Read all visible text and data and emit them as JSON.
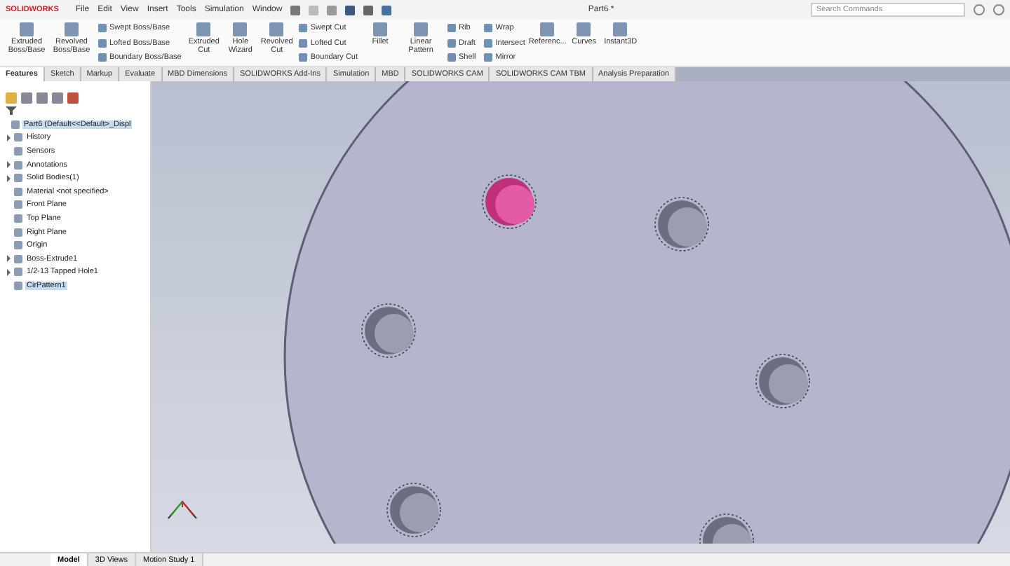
{
  "app": {
    "logo": "SOLIDWORKS",
    "menu": [
      "File",
      "Edit",
      "View",
      "Insert",
      "Tools",
      "Simulation",
      "Window"
    ],
    "title": "Part6 *",
    "search": {
      "placeholder": "Search Commands"
    }
  },
  "ribbon": [
    {
      "kind": "large",
      "label": "Extruded Boss/Base"
    },
    {
      "kind": "large",
      "label": "Revolved Boss/Base"
    },
    {
      "kind": "stack",
      "items": [
        "Swept Boss/Base",
        "Lofted Boss/Base",
        "Boundary Boss/Base"
      ]
    },
    {
      "kind": "large",
      "label": "Extruded Cut"
    },
    {
      "kind": "large",
      "label": "Hole Wizard"
    },
    {
      "kind": "large",
      "label": "Revolved Cut"
    },
    {
      "kind": "stack",
      "items": [
        "Swept Cut",
        "Lofted Cut",
        "Boundary Cut"
      ]
    },
    {
      "kind": "large",
      "label": "Fillet"
    },
    {
      "kind": "large",
      "label": "Linear Pattern"
    },
    {
      "kind": "stack",
      "items": [
        "Rib",
        "Draft",
        "Shell"
      ]
    },
    {
      "kind": "stack",
      "items": [
        "Wrap",
        "Intersect",
        "Mirror"
      ]
    },
    {
      "kind": "large",
      "label": "Referenc..."
    },
    {
      "kind": "large",
      "label": "Curves"
    },
    {
      "kind": "large",
      "label": "Instant3D"
    }
  ],
  "tabs": [
    {
      "label": "Features",
      "selected": true
    },
    {
      "label": "Sketch",
      "selected": false
    },
    {
      "label": "Markup",
      "selected": false
    },
    {
      "label": "Evaluate",
      "selected": false
    },
    {
      "label": "MBD Dimensions",
      "selected": false
    },
    {
      "label": "SOLIDWORKS Add-Ins",
      "selected": false
    },
    {
      "label": "Simulation",
      "selected": false
    },
    {
      "label": "MBD",
      "selected": false
    },
    {
      "label": "SOLIDWORKS CAM",
      "selected": false
    },
    {
      "label": "SOLIDWORKS CAM TBM",
      "selected": false
    },
    {
      "label": "Analysis Preparation",
      "selected": false
    }
  ],
  "tree": {
    "label": "Part6  (Default<<Default>_Displ",
    "selected": true,
    "children": [
      {
        "label": "History",
        "expanded": false,
        "selected": false
      },
      {
        "label": "Sensors",
        "selected": false
      },
      {
        "label": "Annotations",
        "expanded": false,
        "selected": false
      },
      {
        "label": "Solid Bodies(1)",
        "expanded": false,
        "selected": false
      },
      {
        "label": "Material <not specified>",
        "selected": false
      },
      {
        "label": "Front Plane",
        "selected": false
      },
      {
        "label": "Top Plane",
        "selected": false
      },
      {
        "label": "Right Plane",
        "selected": false
      },
      {
        "label": "Origin",
        "selected": false
      },
      {
        "label": "Boss-Extrude1",
        "expanded": false,
        "selected": false
      },
      {
        "label": "1/2-13 Tapped Hole1",
        "expanded": false,
        "selected": false
      },
      {
        "label": "CirPattern1",
        "selected": true
      }
    ]
  },
  "bottom_tabs": [
    {
      "label": "Model",
      "selected": true
    },
    {
      "label": "3D Views",
      "selected": false
    },
    {
      "label": "Motion Study 1",
      "selected": false
    }
  ]
}
